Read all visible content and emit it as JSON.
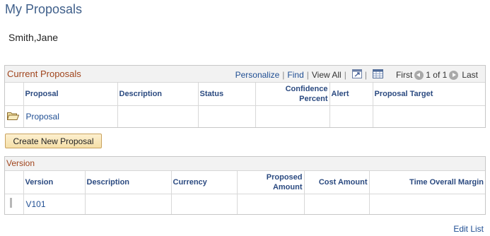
{
  "page": {
    "title": "My Proposals",
    "person": "Smith,Jane"
  },
  "current_proposals": {
    "title": "Current Proposals",
    "toolbar": {
      "personalize": "Personalize",
      "find": "Find",
      "view_all": "View All",
      "first": "First",
      "pages": "1 of 1",
      "last": "Last"
    },
    "columns": [
      "Proposal",
      "Description",
      "Status",
      "Confidence Percent",
      "Alert",
      "Proposal Target"
    ],
    "rows": [
      {
        "proposal": "Proposal",
        "description": "",
        "status": "",
        "confidence": "",
        "alert": "",
        "target": ""
      }
    ]
  },
  "create_button": {
    "label": "Create New Proposal"
  },
  "version_grid": {
    "title": "Version",
    "columns": [
      "Version",
      "Description",
      "Currency",
      "Proposed Amount",
      "Cost Amount",
      "Time Overall Margin"
    ],
    "rows": [
      {
        "version": "V101",
        "description": "",
        "currency": "",
        "proposed_amount": "",
        "cost_amount": "",
        "margin": ""
      }
    ]
  },
  "footer": {
    "edit_list": "Edit List"
  },
  "icons": {
    "folder": "folder-icon",
    "zoom": "zoom-icon",
    "download": "download-icon",
    "prev": "previous-icon",
    "next": "next-icon"
  },
  "colors": {
    "title": "#3f5f8a",
    "grid_title": "#a0451d",
    "link": "#1f4e93",
    "button": "#f5dfa8"
  }
}
